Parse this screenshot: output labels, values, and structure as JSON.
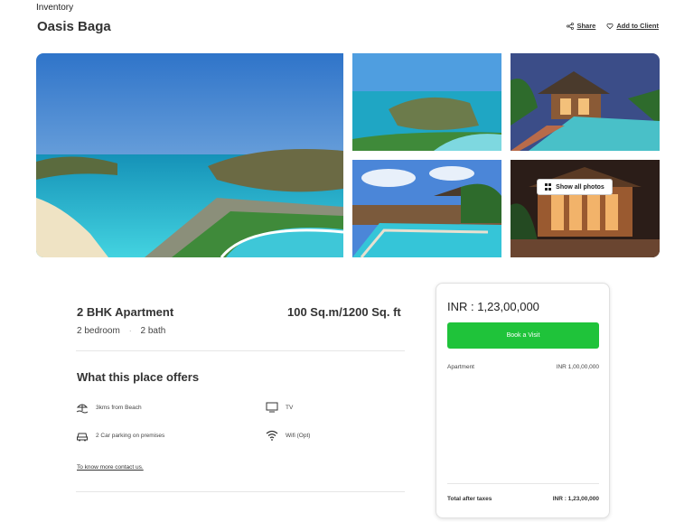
{
  "breadcrumb": "Inventory",
  "title": "Oasis Baga",
  "actions": {
    "share": "Share",
    "add_to_client": "Add to Client"
  },
  "gallery": {
    "show_all_label": "Show all photos"
  },
  "listing": {
    "type": "2 BHK Apartment",
    "area": "100 Sq.m/1200 Sq. ft",
    "bedrooms": "2 bedroom",
    "separator": "·",
    "baths": "2 bath"
  },
  "offers": {
    "title": "What this place offers",
    "items": [
      {
        "label": "3kms from Beach",
        "icon": "beach-umbrella-icon"
      },
      {
        "label": "TV",
        "icon": "tv-icon"
      },
      {
        "label": "2 Car parking on premises",
        "icon": "car-icon"
      },
      {
        "label": "Wifi (Opt)",
        "icon": "wifi-icon"
      }
    ],
    "contact_link": "To know more contact us."
  },
  "pricing": {
    "price": "INR : 1,23,00,000",
    "book_label": "Book a Visit",
    "line_item_label": "Apartment",
    "line_item_value": "INR 1,00,00,000",
    "total_label": "Total after taxes",
    "total_value": "INR : 1,23,00,000"
  },
  "colors": {
    "accent_green": "#1fc33a",
    "text_dark": "#222222"
  }
}
